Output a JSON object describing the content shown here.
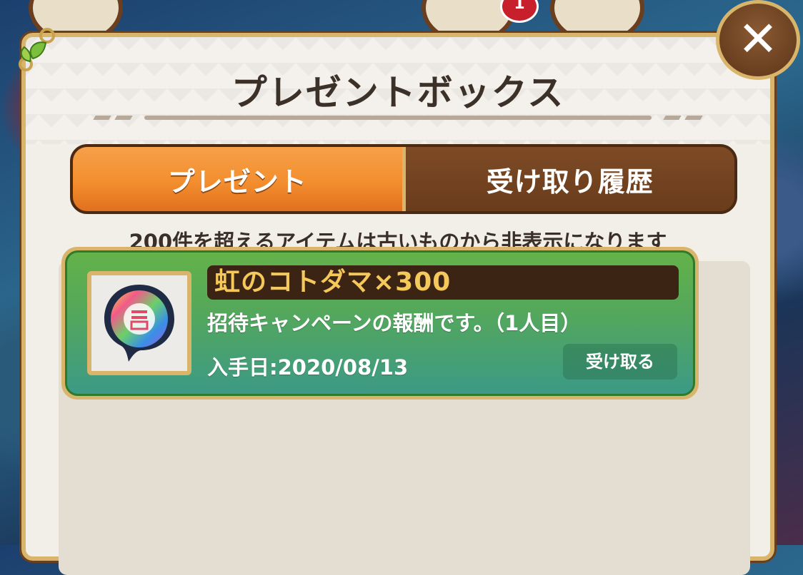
{
  "hud": {
    "badge_count": "1"
  },
  "dialog": {
    "title": "プレゼントボックス",
    "close_label": "✕"
  },
  "tabs": [
    {
      "label": "プレゼント",
      "active": true
    },
    {
      "label": "受け取り履歴",
      "active": false
    }
  ],
  "notice": "200件を超えるアイテムは古いものから非表示になります",
  "items": [
    {
      "name": "虹のコトダマ×300",
      "description": "招待キャンペーンの報酬です。（1人目）",
      "date": "入手日:2020/08/13",
      "receive_label": "受け取る",
      "icon": "rainbow-kotodama-icon"
    }
  ],
  "colors": {
    "tab_active": "#f38e2e",
    "tab_inactive": "#6a3c1c",
    "item_green": "#55a85a",
    "frame_gold": "#d8b56a",
    "name_text": "#f4c85a"
  }
}
